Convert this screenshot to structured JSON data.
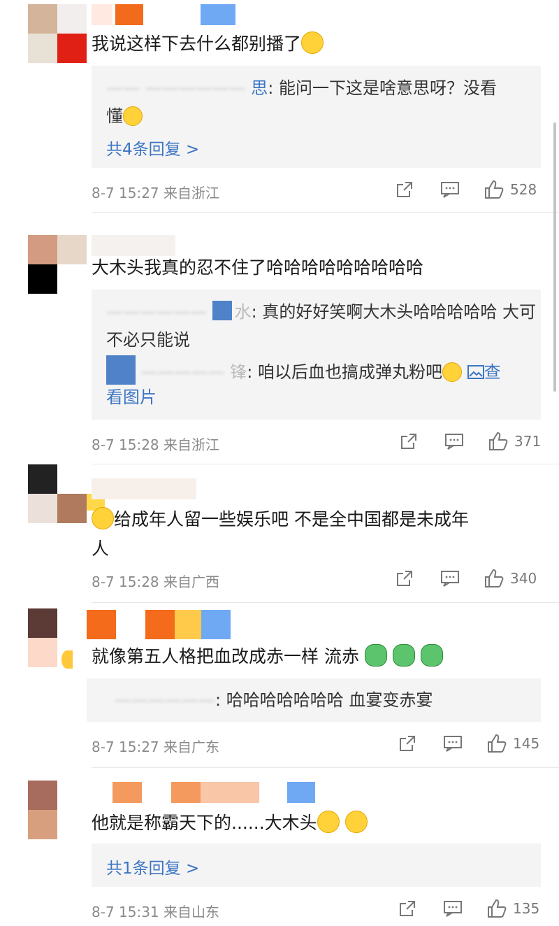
{
  "comments": [
    {
      "text": "我说这样下去什么都别播了",
      "emoji": "sweat-smile-emoji",
      "replies": [
        {
          "name": "思",
          "text": ": 能问一下这是啥意思呀？没看",
          "text2": "懂"
        }
      ],
      "more_replies": "共4条回复 >",
      "time": "8-7 15:27",
      "location": "来自浙江",
      "likes": "528"
    },
    {
      "text": "大木头我真的忍不住了哈哈哈哈哈哈哈哈哈",
      "replies": [
        {
          "name": "水",
          "text": ": 真的好好笑啊大木头哈哈哈哈哈 大可",
          "text2": "不必只能说"
        },
        {
          "name": "锋",
          "text": ": 咱以后血也搞成弹丸粉吧",
          "link": "查",
          "text2": "看图片"
        }
      ],
      "time": "8-7 15:28",
      "location": "来自浙江",
      "likes": "371"
    },
    {
      "text": "给成年人留一些娱乐吧 不是全中国都是未成年",
      "text2": "人",
      "time": "8-7 15:28",
      "location": "来自广西",
      "likes": "340"
    },
    {
      "text": "就像第五人格把血改成赤一样 流赤",
      "replies": [
        {
          "name": "",
          "text": ": 哈哈哈哈哈哈哈 血宴变赤宴"
        }
      ],
      "time": "8-7 15:27",
      "location": "来自广东",
      "likes": "145"
    },
    {
      "text": "他就是称霸天下的......大木头",
      "more_replies": "共1条回复 >",
      "time": "8-7 15:31",
      "location": "来自山东",
      "likes": "135"
    }
  ],
  "colors": {
    "link": "#3b74c4",
    "reply_bg": "#f4f4f4",
    "meta": "#8a8a8a"
  }
}
